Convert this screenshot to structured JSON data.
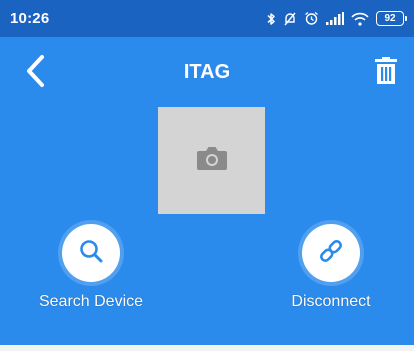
{
  "status_bar": {
    "time": "10:26",
    "icons": [
      "bluetooth-icon",
      "mute-icon",
      "alarm-icon",
      "signal-icon",
      "wifi-icon"
    ],
    "battery": "92"
  },
  "header": {
    "title": "ITAG",
    "back_icon": "chevron-left-icon",
    "delete_icon": "trash-icon"
  },
  "photo": {
    "icon": "camera-icon"
  },
  "actions": {
    "search": {
      "label": "Search Device",
      "icon": "search-icon"
    },
    "disconnect": {
      "label": "Disconnect",
      "icon": "link-icon"
    }
  },
  "colors": {
    "status_bar": "#1b63c0",
    "background": "#2b8bec",
    "icon_blue": "#2b8bec",
    "photo_placeholder": "#d4d4d4",
    "camera_icon": "#8a8a8a"
  }
}
